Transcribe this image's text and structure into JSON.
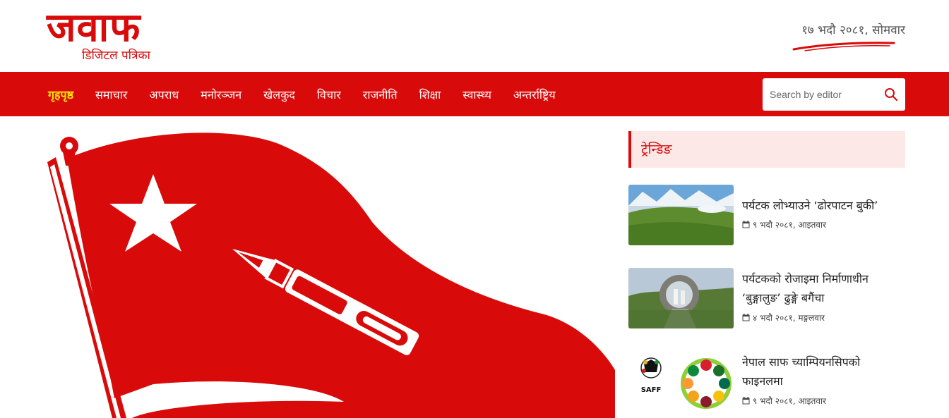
{
  "site": {
    "logo_title": "जवाफ",
    "logo_subtitle": "डिजिटल पत्रिका",
    "date": "१७ भदौ २०८१, सोमवार"
  },
  "nav": {
    "items": [
      {
        "label": "गृहपृष्ठ",
        "active": true
      },
      {
        "label": "समाचार"
      },
      {
        "label": "अपराध"
      },
      {
        "label": "मनोरञ्जन"
      },
      {
        "label": "खेलकुद"
      },
      {
        "label": "विचार"
      },
      {
        "label": "राजनीति"
      },
      {
        "label": "शिक्षा"
      },
      {
        "label": "स्वास्थ्य"
      },
      {
        "label": "अन्तर्राष्ट्रिय"
      }
    ]
  },
  "search": {
    "placeholder": "Search by editor",
    "icon": "search-icon"
  },
  "trending": {
    "title": "ट्रेन्डिङ",
    "items": [
      {
        "title": "पर्यटक लोभ्याउने ‘ढोरपाटन बुकी’",
        "date": "९ भदौ २०८१, आइतवार",
        "icon": "calendar-icon"
      },
      {
        "title": "पर्यटकको रोजाइमा निर्माणाधीन ‘बुङ्गालुङ’ ढुङ्गे बगैंचा",
        "date": "४ भदौ २०८१, मङ्गलवार",
        "icon": "calendar-icon"
      },
      {
        "title": "नेपाल साफ च्याम्पियनसिपको फाइनलमा",
        "date": "९ भदौ २०८१, आइतवार",
        "icon": "calendar-icon"
      }
    ],
    "thumb3_logo": "SAFF"
  },
  "colors": {
    "brand_red": "#d90a0a",
    "active_nav": "#ffe600",
    "trending_bg": "#fde8e8"
  }
}
